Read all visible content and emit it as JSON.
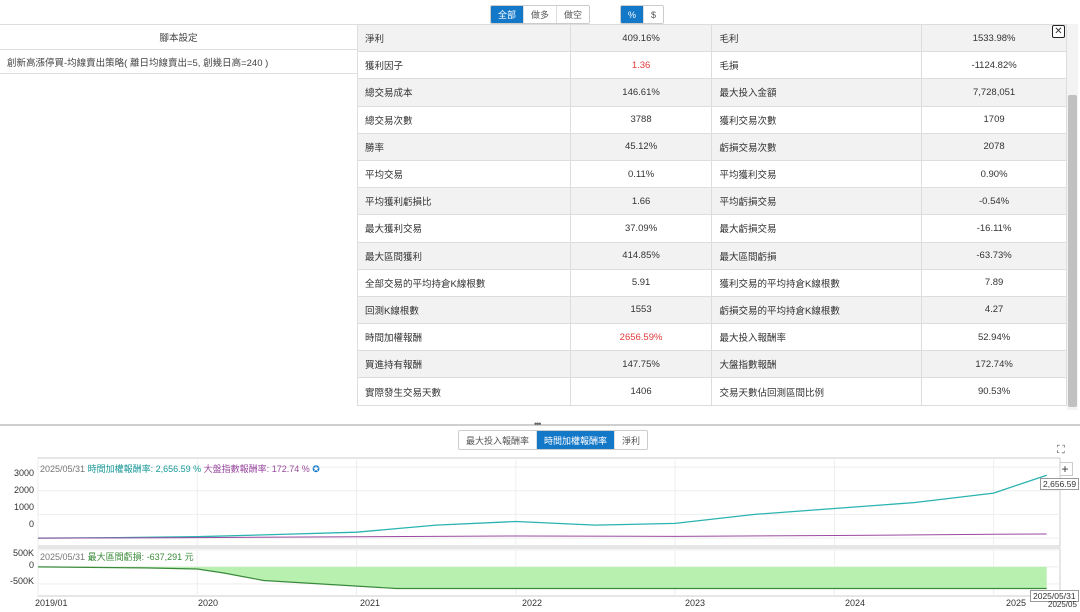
{
  "toolbar": {
    "direction": [
      "全部",
      "做多",
      "做空"
    ],
    "units": [
      "%",
      "$"
    ]
  },
  "left_panel": {
    "header": "腳本設定",
    "strategy": "創新高漲停買-均線賣出策略( 離日均線賣出=5, 創幾日高=240 )"
  },
  "stats": [
    [
      "淨利",
      "409.16%",
      "毛利",
      "1533.98%"
    ],
    [
      "獲利因子",
      "1.36",
      "毛損",
      "-1124.82%"
    ],
    [
      "總交易成本",
      "146.61%",
      "最大投入金額",
      "7,728,051"
    ],
    [
      "總交易次數",
      "3788",
      "獲利交易次數",
      "1709"
    ],
    [
      "勝率",
      "45.12%",
      "虧損交易次數",
      "2078"
    ],
    [
      "平均交易",
      "0.11%",
      "平均獲利交易",
      "0.90%"
    ],
    [
      "平均獲利虧損比",
      "1.66",
      "平均虧損交易",
      "-0.54%"
    ],
    [
      "最大獲利交易",
      "37.09%",
      "最大虧損交易",
      "-16.11%"
    ],
    [
      "最大區間獲利",
      "414.85%",
      "最大區間虧損",
      "-63.73%"
    ],
    [
      "全部交易的平均持倉K線根數",
      "5.91",
      "獲利交易的平均持倉K線根數",
      "7.89"
    ],
    [
      "回測K線根數",
      "1553",
      "虧損交易的平均持倉K線根數",
      "4.27"
    ],
    [
      "時間加權報酬",
      "2656.59%",
      "最大投入報酬率",
      "52.94%"
    ],
    [
      "買進持有報酬",
      "147.75%",
      "大盤指數報酬",
      "172.74%"
    ],
    [
      "實際發生交易天數",
      "1406",
      "交易天數佔回測區間比例",
      "90.53%"
    ]
  ],
  "highlight_color": "#e23b3b",
  "accent_color": "#1478c8",
  "chart_tabs": [
    "最大投入報酬率",
    "時間加權報酬率",
    "淨利"
  ],
  "chart_data": [
    {
      "type": "line",
      "legend_date": "2025/05/31",
      "series": [
        {
          "name": "時間加權報酬率",
          "legend_value": "2,656.59 %",
          "color": "#2bb3b0",
          "x": [
            "2019-01",
            "2019-07",
            "2020-01",
            "2020-07",
            "2021-01",
            "2021-07",
            "2022-01",
            "2022-07",
            "2023-01",
            "2023-07",
            "2024-01",
            "2024-07",
            "2025-01",
            "2025-05"
          ],
          "values": [
            0,
            20,
            60,
            150,
            250,
            550,
            700,
            550,
            620,
            1000,
            1250,
            1500,
            1900,
            2656.59
          ]
        },
        {
          "name": "大盤指數報酬率",
          "legend_value": "172.74 %",
          "color": "#9a4aa0",
          "x": [
            "2019-01",
            "2020-01",
            "2021-01",
            "2022-01",
            "2023-01",
            "2024-01",
            "2025-01",
            "2025-05"
          ],
          "values": [
            0,
            20,
            60,
            90,
            70,
            110,
            160,
            172.74
          ]
        }
      ],
      "y_ticks": [
        "3000",
        "2000",
        "1000",
        "0"
      ],
      "ylim": [
        -250,
        3300
      ],
      "end_label": "2,656.59"
    },
    {
      "type": "area",
      "legend_date": "2025/05/31",
      "series": [
        {
          "name": "最大區間虧損",
          "legend_value": "-637,291 元",
          "color": "#3a8a3a",
          "x": [
            "2019-01",
            "2019-09",
            "2020-01",
            "2020-03",
            "2020-06",
            "2021-04",
            "2025-05"
          ],
          "values": [
            0,
            -30000,
            -60000,
            -180000,
            -400000,
            -637291,
            -637291
          ]
        }
      ],
      "y_ticks": [
        "500K",
        "0",
        "-500K"
      ],
      "ylim": [
        -800000,
        500000
      ]
    }
  ],
  "x_axis": [
    "2019/01",
    "2020",
    "2021",
    "2022",
    "2023",
    "2024",
    "2025",
    "2025/05/31",
    "2025/05"
  ]
}
